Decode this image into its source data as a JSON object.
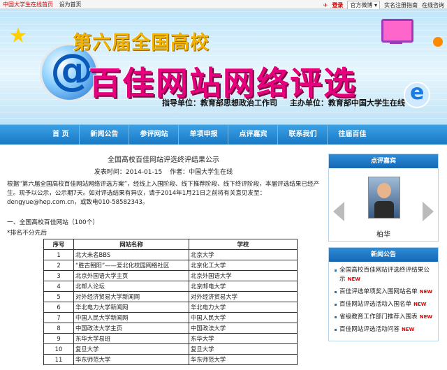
{
  "topbar": {
    "site_name": "中国大学生在线首页",
    "set_home": "设为首页",
    "login": "登录",
    "weibo_select": "官方微博",
    "realname": "实名注册指南",
    "online_help": "在线咨询"
  },
  "banner": {
    "sub_title": "第六届全国高校",
    "main_title": "百佳网站网络评选",
    "guide_unit": "指导单位：教育部思想政治工作司",
    "host_unit": "主办单位：教育部中国大学生在线"
  },
  "nav": [
    "首 页",
    "新闻公告",
    "参评网站",
    "单项申报",
    "点评嘉宾",
    "联系我们",
    "往届百佳"
  ],
  "article": {
    "title": "全国高校百佳网站评选终评结果公示",
    "time_label": "发表时间：2014-01-15",
    "author_label": "作者：中国大学生在线",
    "paragraph": "根据“第六届全国高校百佳网站网络评选方案”，经线上入围阶段、线下推荐阶段、线下终评阶段，本届评选结果已经产生。现予以公示，公示期7天。如对评选结果有异议，请于2014年1月21日之前将有关意见发至：dengyue@hep.com.cn，或致电010-58582343。",
    "section": "一、全国高校百佳网站（100个）",
    "note": "*排名不分先后",
    "table_headers": [
      "序号",
      "网站名称",
      "学校"
    ],
    "rows": [
      [
        "1",
        "北大未名BBS",
        "北京大学"
      ],
      [
        "2",
        "“胜古朝阳”——爱北化校园网络社区",
        "北京化工大学"
      ],
      [
        "3",
        "北京外国语大学主页",
        "北京外国语大学"
      ],
      [
        "4",
        "北邮人论坛",
        "北京邮电大学"
      ],
      [
        "5",
        "对外经济贸易大学新闻网",
        "对外经济贸易大学"
      ],
      [
        "6",
        "华北电力大学新闻网",
        "华北电力大学"
      ],
      [
        "7",
        "中国人民大学新闻网",
        "中国人民大学"
      ],
      [
        "8",
        "中国政法大学主页",
        "中国政法大学"
      ],
      [
        "9",
        "东华大学易班",
        "东华大学"
      ],
      [
        "10",
        "复旦大学",
        "复旦大学"
      ],
      [
        "11",
        "华东师范大学",
        "华东师范大学"
      ]
    ]
  },
  "sidebar": {
    "judges_title": "点评嘉宾",
    "judge_name": "柏华",
    "news_title": "新闻公告",
    "news_items": [
      "全国高校百佳网站评选终评结果公示",
      "百佳评选单项奖入围网站名单",
      "百佳网站评选活动入围名单",
      "省级教育工作部门推荐入围表",
      "百佳网站评选活动问答"
    ],
    "new_badge": "NEW"
  }
}
